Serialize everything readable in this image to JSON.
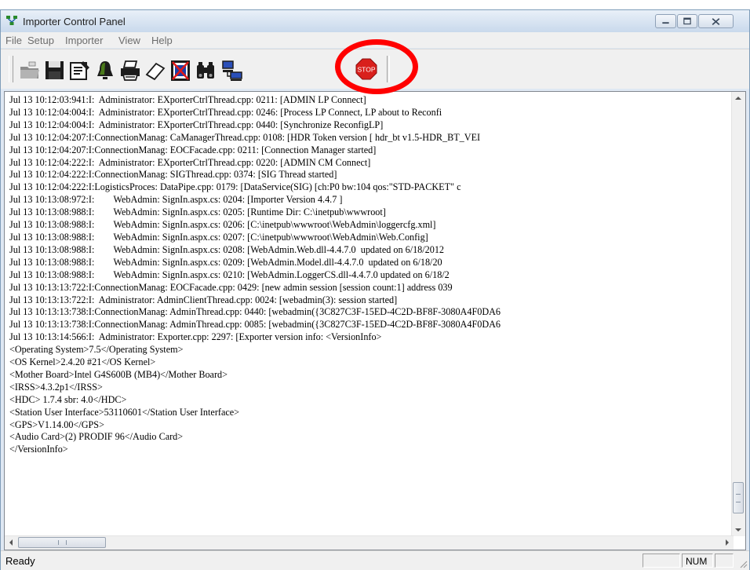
{
  "window": {
    "title": "Importer Control Panel",
    "app_icon": "network-icon"
  },
  "menu": [
    "File",
    "Setup",
    "Importer",
    "View",
    "Help"
  ],
  "toolbar": {
    "buttons": [
      {
        "icon": "import-folder-icon"
      },
      {
        "icon": "save-floppy-icon"
      },
      {
        "icon": "properties-icon"
      },
      {
        "icon": "bell-icon"
      },
      {
        "icon": "printer-icon"
      },
      {
        "icon": "eraser-icon"
      },
      {
        "icon": "clear-log-icon"
      },
      {
        "icon": "binoculars-icon"
      },
      {
        "icon": "network-computers-icon"
      },
      {
        "icon": "stop-sign-icon",
        "label": "STOP"
      }
    ]
  },
  "log": [
    "Jul 13 10:12:03:941:I:  Administrator: EXporterCtrlThread.cpp: 0211: [ADMIN LP Connect]",
    "Jul 13 10:12:04:004:I:  Administrator: EXporterCtrlThread.cpp: 0246: [Process LP Connect, LP about to Reconfi",
    "Jul 13 10:12:04:004:I:  Administrator: EXporterCtrlThread.cpp: 0440: [Synchronize ReconfigLP]",
    "Jul 13 10:12:04:207:I:ConnectionManag: CaManagerThread.cpp: 0108: [HDR Token version [ hdr_bt v1.5-HDR_BT_VEI",
    "Jul 13 10:12:04:207:I:ConnectionManag: EOCFacade.cpp: 0211: [Connection Manager started]",
    "Jul 13 10:12:04:222:I:  Administrator: EXporterCtrlThread.cpp: 0220: [ADMIN CM Connect]",
    "Jul 13 10:12:04:222:I:ConnectionManag: SIGThread.cpp: 0374: [SIG Thread started]",
    "Jul 13 10:12:04:222:I:LogisticsProces: DataPipe.cpp: 0179: [DataService(SIG) [ch:P0 bw:104 qos:\"STD-PACKET\" c",
    "Jul 13 10:13:08:972:I:        WebAdmin: SignIn.aspx.cs: 0204: [Importer Version 4.4.7 ]",
    "Jul 13 10:13:08:988:I:        WebAdmin: SignIn.aspx.cs: 0205: [Runtime Dir: C:\\inetpub\\wwwroot]",
    "Jul 13 10:13:08:988:I:        WebAdmin: SignIn.aspx.cs: 0206: [C:\\inetpub\\wwwroot\\WebAdmin\\loggercfg.xml]",
    "Jul 13 10:13:08:988:I:        WebAdmin: SignIn.aspx.cs: 0207: [C:\\inetpub\\wwwroot\\WebAdmin\\Web.Config]",
    "Jul 13 10:13:08:988:I:        WebAdmin: SignIn.aspx.cs: 0208: [WebAdmin.Web.dll-4.4.7.0  updated on 6/18/2012",
    "Jul 13 10:13:08:988:I:        WebAdmin: SignIn.aspx.cs: 0209: [WebAdmin.Model.dll-4.4.7.0  updated on 6/18/20",
    "Jul 13 10:13:08:988:I:        WebAdmin: SignIn.aspx.cs: 0210: [WebAdmin.LoggerCS.dll-4.4.7.0 updated on 6/18/2",
    "Jul 13 10:13:13:722:I:ConnectionManag: EOCFacade.cpp: 0429: [new admin session [session count:1] address 039",
    "Jul 13 10:13:13:722:I:  Administrator: AdminClientThread.cpp: 0024: [webadmin(3): session started]",
    "Jul 13 10:13:13:738:I:ConnectionManag: AdminThread.cpp: 0440: [webadmin({3C827C3F-15ED-4C2D-BF8F-3080A4F0DA6",
    "Jul 13 10:13:13:738:I:ConnectionManag: AdminThread.cpp: 0085: [webadmin({3C827C3F-15ED-4C2D-BF8F-3080A4F0DA6",
    "Jul 13 10:13:14:566:I:  Administrator: Exporter.cpp: 2297: [Exporter version info: <VersionInfo>",
    "<Operating System>7.5</Operating System>",
    "<OS Kernel>2.4.20 #21</OS Kernel>",
    "<Mother Board>Intel G4S600B (MB4)</Mother Board>",
    "<IRSS>4.3.2p1</IRSS>",
    "<HDC> 1.7.4 sbr: 4.0</HDC>",
    "<Station User Interface>53110601</Station User Interface>",
    "<GPS>V1.14.00</GPS>",
    "<Audio Card>(2) PRODIF 96</Audio Card>",
    "</VersionInfo>"
  ],
  "status": {
    "text": "Ready",
    "panel_num": "NUM"
  },
  "colors": {
    "annotation_circle": "#ff0000",
    "stop_sign": "#d9201c"
  }
}
